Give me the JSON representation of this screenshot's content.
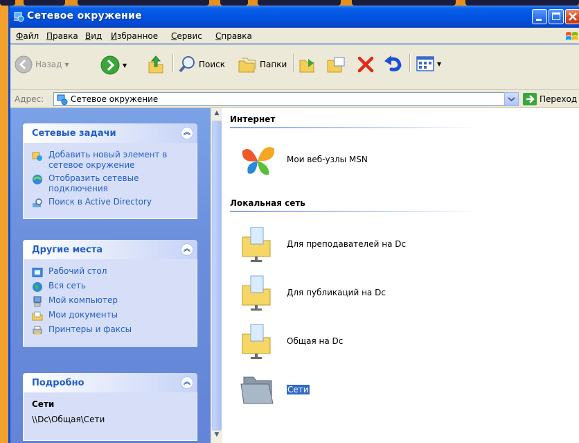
{
  "window": {
    "title": "Сетевое окружение",
    "title_color": "#0054e3"
  },
  "menu": {
    "items": [
      "Файл",
      "Правка",
      "Вид",
      "Избранное",
      "Сервис",
      "Справка"
    ]
  },
  "toolbar": {
    "back_label": "Назад",
    "search_label": "Поиск",
    "folders_label": "Папки"
  },
  "address": {
    "label": "Адрес:",
    "value": "Сетевое окружение",
    "go_label": "Переход"
  },
  "taskpane": {
    "network_tasks": {
      "title": "Сетевые задачи",
      "items": [
        {
          "label": "Добавить новый элемент в сетевое окружение",
          "icon": "add-network-place-icon"
        },
        {
          "label": "Отобразить сетевые подключения",
          "icon": "network-connections-icon"
        },
        {
          "label": "Поиск в Active Directory",
          "icon": "search-directory-icon"
        }
      ]
    },
    "other_places": {
      "title": "Другие места",
      "items": [
        {
          "label": "Рабочий стол",
          "icon": "desktop-icon"
        },
        {
          "label": "Вся сеть",
          "icon": "entire-network-icon"
        },
        {
          "label": "Мой компьютер",
          "icon": "my-computer-icon"
        },
        {
          "label": "Мои документы",
          "icon": "my-documents-icon"
        },
        {
          "label": "Принтеры и факсы",
          "icon": "printers-icon"
        }
      ]
    },
    "details": {
      "title": "Подробно",
      "name": "Сети",
      "path": "\\\\Dc\\Общая\\Сети"
    }
  },
  "files": {
    "sections": [
      {
        "title": "Интернет"
      },
      {
        "title": "Локальная сеть"
      }
    ],
    "items": [
      {
        "name": "Мои веб-узлы MSN",
        "icon": "msn-butterfly-icon"
      },
      {
        "name": "Для преподавателей на Dc",
        "icon": "network-folder-icon"
      },
      {
        "name": "Для публикаций на Dc",
        "icon": "network-folder-icon"
      },
      {
        "name": "Общая на Dc",
        "icon": "network-folder-icon"
      },
      {
        "name": "Сети",
        "icon": "folder-icon",
        "selected": true
      }
    ]
  },
  "colors": {
    "taskpane_bg": "#6b8fdc",
    "task_link": "#215dc6",
    "selection": "#316ac5",
    "slide_accent": "#f2a02c"
  }
}
